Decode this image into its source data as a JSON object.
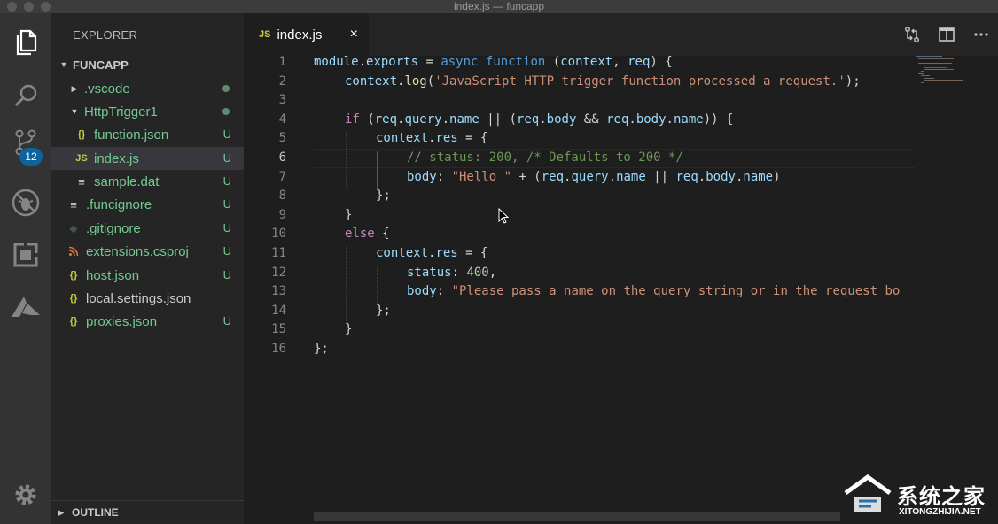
{
  "window": {
    "title": "index.js — funcapp"
  },
  "activity_bar": {
    "items": [
      "files-icon",
      "search-icon",
      "source-control-icon",
      "debug-icon",
      "extensions-icon",
      "azure-icon"
    ],
    "scm_badge": "12",
    "settings": "gear-icon"
  },
  "sidebar": {
    "title": "EXPLORER",
    "folder": "FUNCAPP",
    "files": [
      {
        "name": ".vscode",
        "icon": "chevron-right",
        "status": "dot"
      },
      {
        "name": "HttpTrigger1",
        "icon": "chevron-down",
        "status": "dot"
      },
      {
        "name": "function.json",
        "icon": "{}",
        "status": "U"
      },
      {
        "name": "index.js",
        "icon": "JS",
        "status": "U"
      },
      {
        "name": "sample.dat",
        "icon": "lines",
        "status": "U"
      },
      {
        "name": ".funcignore",
        "icon": "lines",
        "status": "U"
      },
      {
        "name": ".gitignore",
        "icon": "diamond",
        "status": "U"
      },
      {
        "name": "extensions.csproj",
        "icon": "rss",
        "status": "U"
      },
      {
        "name": "host.json",
        "icon": "{}",
        "status": "U"
      },
      {
        "name": "local.settings.json",
        "icon": "{}",
        "status": ""
      },
      {
        "name": "proxies.json",
        "icon": "{}",
        "status": "U"
      }
    ],
    "outline_label": "OUTLINE"
  },
  "tabs": [
    {
      "label": "index.js",
      "icon": "JS",
      "close": "×"
    }
  ],
  "editor": {
    "line_numbers": [
      "1",
      "2",
      "3",
      "4",
      "5",
      "6",
      "7",
      "8",
      "9",
      "10",
      "11",
      "12",
      "13",
      "14",
      "15",
      "16"
    ],
    "active_line": "6",
    "code": {
      "l1_a": "module",
      "l1_b": ".",
      "l1_c": "exports",
      "l1_d": " = ",
      "l1_e": "async",
      "l1_f": " ",
      "l1_g": "function",
      "l1_h": " (",
      "l1_i": "context",
      "l1_j": ", ",
      "l1_k": "req",
      "l1_l": ") {",
      "l2_a": "context",
      "l2_b": ".",
      "l2_c": "log",
      "l2_d": "(",
      "l2_e": "'JavaScript HTTP trigger function processed a request.'",
      "l2_f": ");",
      "l4_a": "if",
      "l4_b": " (",
      "l4_c": "req",
      "l4_d": ".",
      "l4_e": "query",
      "l4_f": ".",
      "l4_g": "name",
      "l4_h": " || (",
      "l4_i": "req",
      "l4_j": ".",
      "l4_k": "body",
      "l4_l": " && ",
      "l4_m": "req",
      "l4_n": ".",
      "l4_o": "body",
      "l4_p": ".",
      "l4_q": "name",
      "l4_r": ")) {",
      "l5_a": "context",
      "l5_b": ".",
      "l5_c": "res",
      "l5_d": " = {",
      "l6_a": "// status: 200, /* Defaults to 200 */",
      "l7_a": "body",
      "l7_b": ": ",
      "l7_c": "\"Hello \"",
      "l7_d": " + (",
      "l7_e": "req",
      "l7_f": ".",
      "l7_g": "query",
      "l7_h": ".",
      "l7_i": "name",
      "l7_j": " || ",
      "l7_k": "req",
      "l7_l": ".",
      "l7_m": "body",
      "l7_n": ".",
      "l7_o": "name",
      "l7_p": ")",
      "l8_a": "};",
      "l9_a": "}",
      "l10_a": "else",
      "l10_b": " {",
      "l11_a": "context",
      "l11_b": ".",
      "l11_c": "res",
      "l11_d": " = {",
      "l12_a": "status",
      "l12_b": ": ",
      "l12_c": "400",
      "l12_d": ",",
      "l13_a": "body",
      "l13_b": ": ",
      "l13_c": "\"Please pass a name on the query string or in the request bo",
      "l14_a": "};",
      "l15_a": "}",
      "l16_a": "};"
    }
  },
  "watermark": {
    "brand": "系统之家",
    "url": "XITONGZHIJIA.NET"
  },
  "colors": {
    "accent_badge": "#0e639c",
    "untracked_green": "#73c991",
    "keyword": "#569cd6",
    "string": "#ce9178",
    "comment": "#6a9955"
  }
}
